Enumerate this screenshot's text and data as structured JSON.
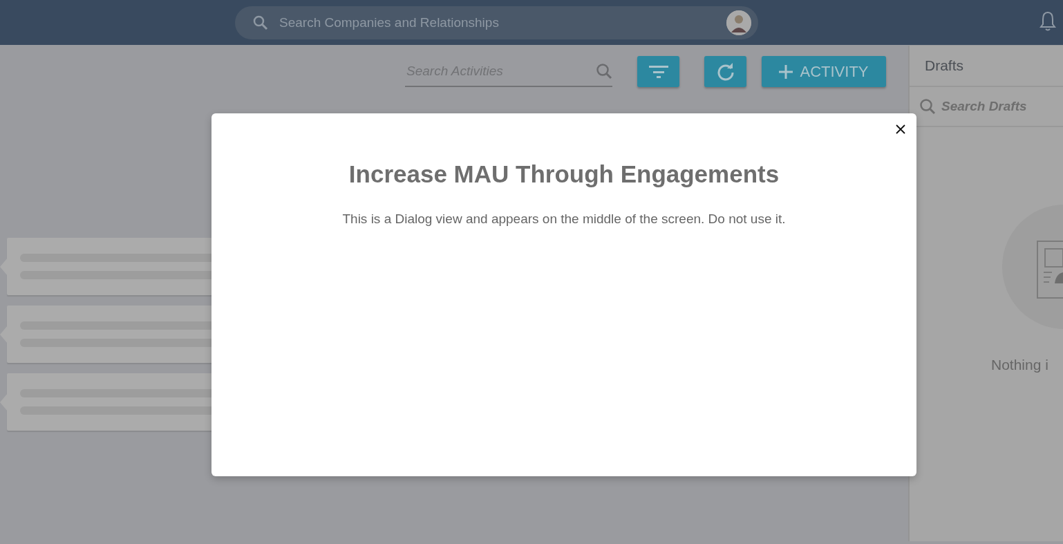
{
  "header": {
    "search": {
      "placeholder": "Search Companies and Relationships"
    }
  },
  "toolbar": {
    "search": {
      "placeholder": "Search Activities"
    },
    "buttons": [
      {
        "kind": "filter"
      },
      {
        "kind": "refresh"
      },
      {
        "kind": "add",
        "label": "ACTIVITY"
      }
    ]
  },
  "activity_placeholders": [
    {
      "kind": "skeleton"
    },
    {
      "kind": "skeleton"
    },
    {
      "kind": "skeleton"
    }
  ],
  "drafts": {
    "title": "Drafts",
    "search": {
      "placeholder": "Search Drafts"
    },
    "empty_text": "Nothing i"
  },
  "dialog": {
    "title": "Increase MAU Through Engagements",
    "text": "This is a Dialog view and appears on the middle of the screen. Do not use it."
  }
}
